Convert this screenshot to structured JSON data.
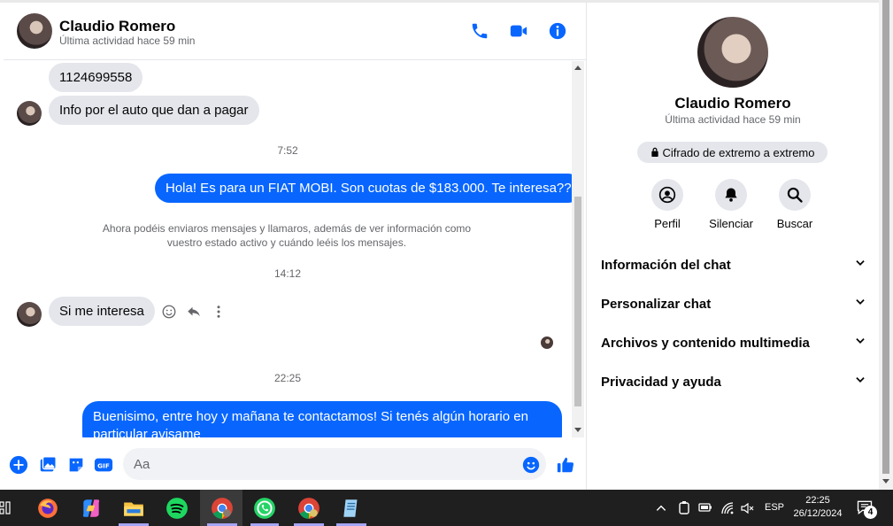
{
  "contact": {
    "name": "Claudio Romero",
    "status": "Última actividad hace 59 min"
  },
  "header_icons": [
    "phone-icon",
    "video-icon",
    "info-icon"
  ],
  "messages": {
    "m1": "1124699558",
    "m2": "Info por el auto que dan a pagar",
    "t1": "7:52",
    "m3": "Hola! Es para un FIAT MOBI. Son cuotas de $183.000. Te interesa??",
    "notice": "Ahora podéis enviaros mensajes y llamaros, además de ver información como vuestro estado activo y cuándo leéis los mensajes.",
    "t2": "14:12",
    "m4": "Si me interesa",
    "t3": "22:25",
    "m5": "Buenisimo, entre hoy y mañana te contactamos! Si tenés algún horario en particular avisame"
  },
  "composer": {
    "placeholder": "Aa"
  },
  "info_panel": {
    "name": "Claudio Romero",
    "status": "Última actividad hace 59 min",
    "e2e": "Cifrado de extremo a extremo",
    "actions": [
      {
        "label": "Perfil"
      },
      {
        "label": "Silenciar"
      },
      {
        "label": "Buscar"
      }
    ],
    "sections": [
      {
        "label": "Información del chat"
      },
      {
        "label": "Personalizar chat"
      },
      {
        "label": "Archivos y contenido multimedia"
      },
      {
        "label": "Privacidad y ayuda"
      }
    ]
  },
  "taskbar": {
    "language": "ESP",
    "time": "22:25",
    "date": "26/12/2024",
    "notifications": "4"
  },
  "colors": {
    "accent": "#0866ff",
    "bubble_in": "#e4e6eb",
    "taskbar": "#1f1f1f"
  }
}
